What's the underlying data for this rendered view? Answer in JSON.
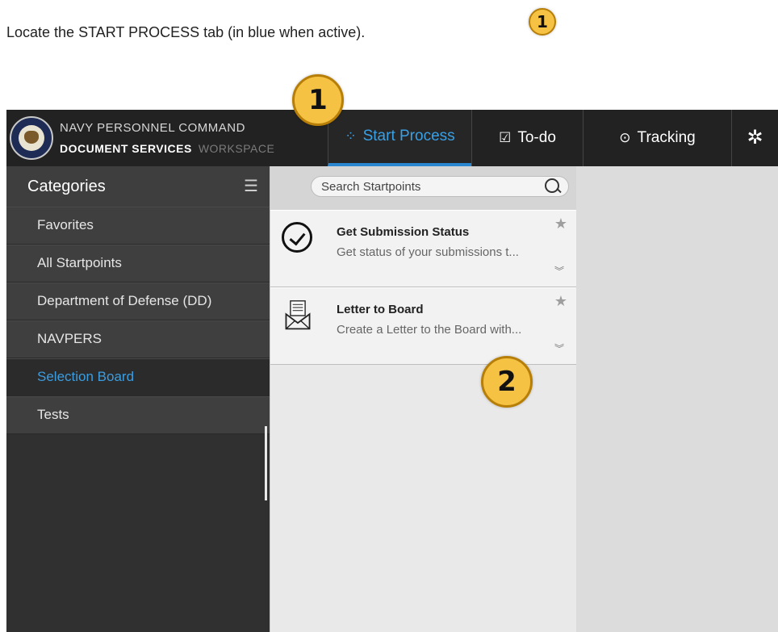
{
  "instruction": {
    "text": "Locate the START PROCESS tab (in blue when active).",
    "badge": "1"
  },
  "callouts": {
    "one": "1",
    "two": "2"
  },
  "brand": {
    "line1": "NAVY PERSONNEL COMMAND",
    "line2": "DOCUMENT SERVICES",
    "workspace": "WORKSPACE"
  },
  "nav": {
    "start_process": "Start Process",
    "todo": "To-do",
    "tracking": "Tracking",
    "settings_icon": "gear-icon"
  },
  "sidebar": {
    "title": "Categories",
    "items": [
      "Favorites",
      "All Startpoints",
      "Department of Defense (DD)",
      "NAVPERS",
      "Selection Board",
      "Tests"
    ],
    "active_index": 4
  },
  "startpoints": {
    "search_placeholder": "Search Startpoints",
    "cards": [
      {
        "title": "Get Submission Status",
        "description": "Get status of your submissions t...",
        "icon": "check-circle-icon"
      },
      {
        "title": "Letter to Board",
        "description": "Create a Letter to the Board with...",
        "icon": "envelope-letter-icon"
      }
    ]
  },
  "colors": {
    "accent": "#39a0e6",
    "topbar": "#222222",
    "sidebar": "#303030",
    "badge": "#f6c244"
  }
}
